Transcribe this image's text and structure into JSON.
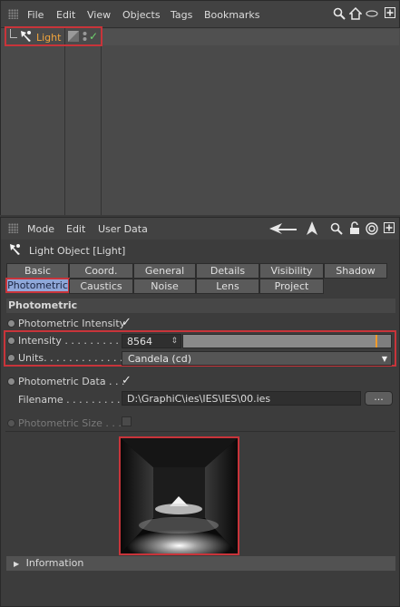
{
  "object_manager": {
    "menu": [
      "File",
      "Edit",
      "View",
      "Objects",
      "Tags",
      "Bookmarks"
    ],
    "icons": [
      "search-icon",
      "home-icon",
      "eye-icon",
      "new-window-icon"
    ],
    "object_name": "Light",
    "tags": [
      "compositing-tag-icon",
      "visibility-toggle-icon",
      "enabled-check-icon"
    ]
  },
  "attribute_manager": {
    "menu": [
      "Mode",
      "Edit",
      "User Data"
    ],
    "icons": [
      "back-arrow-icon",
      "cursor-icon",
      "search-icon",
      "lock-icon",
      "target-icon",
      "new-window-icon"
    ],
    "object_title": "Light Object [Light]",
    "tabs_row1": [
      "Basic",
      "Coord.",
      "General",
      "Details",
      "Visibility",
      "Shadow"
    ],
    "tabs_row2": [
      "Photometric",
      "Caustics",
      "Noise",
      "Lens",
      "Project"
    ],
    "active_tab": "Photometric",
    "section_title": "Photometric",
    "props": {
      "photometric_intensity_label": "Photometric Intensity",
      "photometric_intensity_checked": "✓",
      "intensity_label": "Intensity . . . . . . . . . . .",
      "intensity_value": "8564",
      "intensity_slider_fraction": 0.93,
      "units_label": "Units. . . . . . . . . . . . . .",
      "units_value": "Candela (cd)",
      "photometric_data_label": "Photometric Data . . .",
      "photometric_data_checked": "✓",
      "filename_label": "Filename . . . . . . . . . .",
      "filename_value": "D:\\GraphiC\\ies\\IES\\IES\\00.ies",
      "browse_button": "...",
      "photometric_size_label": "Photometric Size . . . ."
    },
    "info_bar": "Information"
  },
  "colors": {
    "accent_orange": "#f09a2a",
    "highlight_red": "#c8343a",
    "active_tab": "#8fa7d8",
    "light_label": "#f2a53c"
  }
}
